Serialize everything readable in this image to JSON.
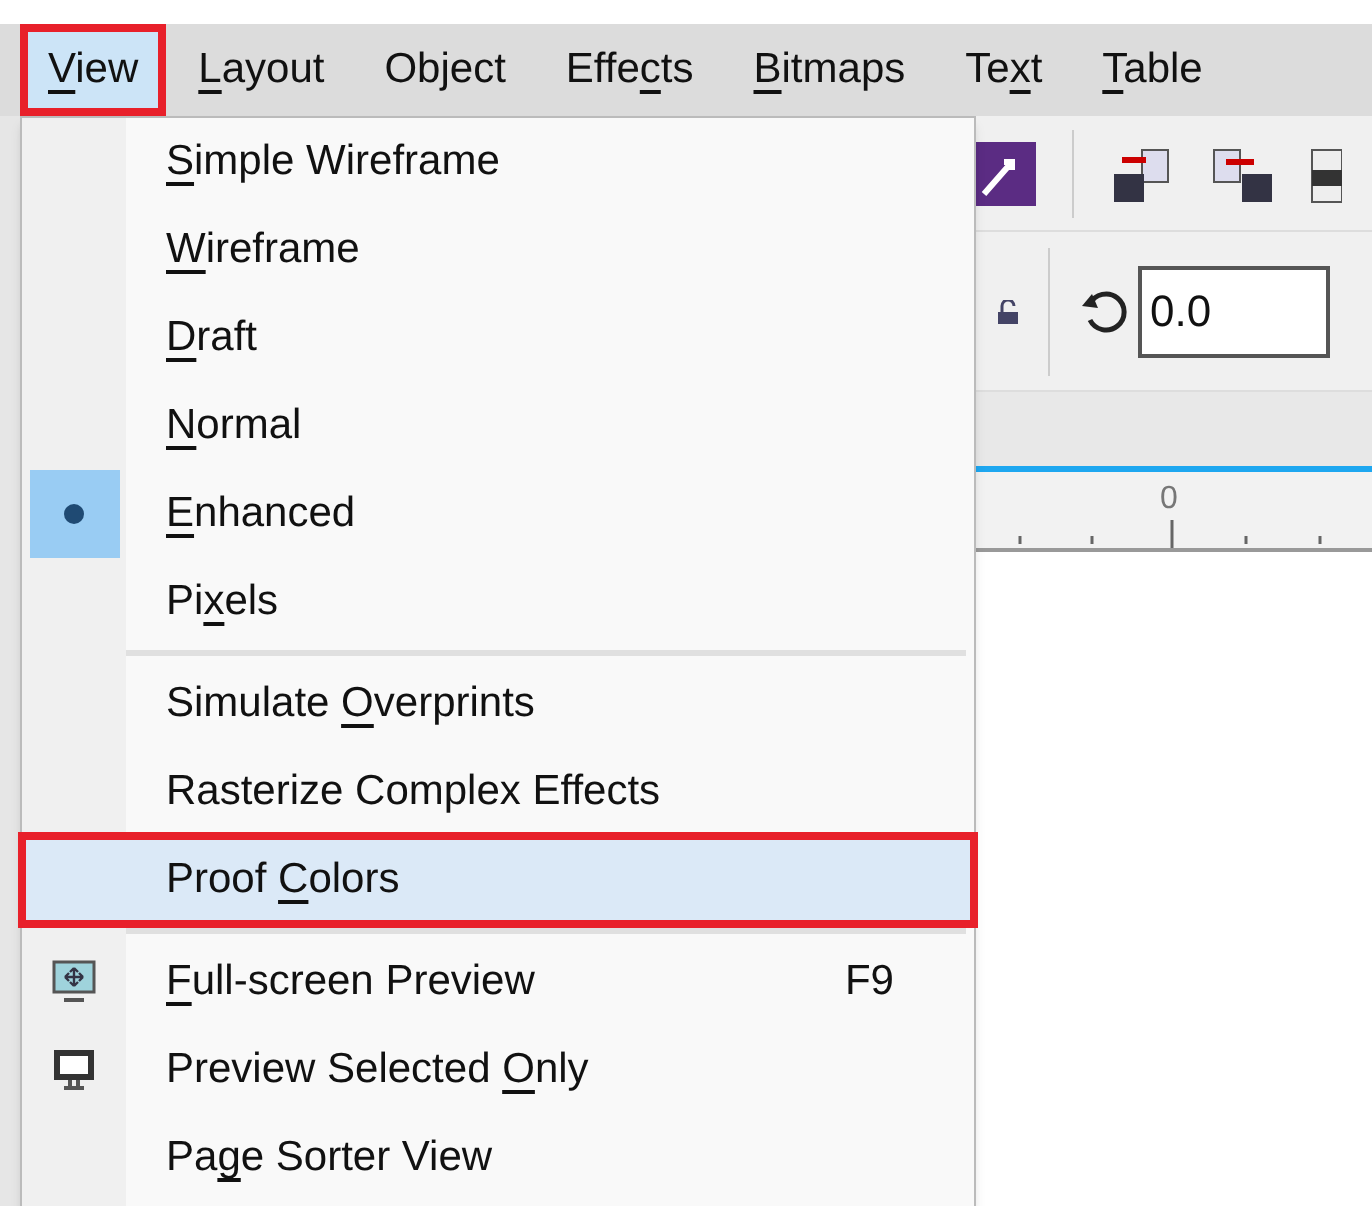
{
  "menu_bar": [
    {
      "label": {
        "key": "V",
        "after": "iew"
      },
      "selected": true,
      "annotated": true
    },
    {
      "label": {
        "key": "L",
        "after": "ayout"
      },
      "selected": false,
      "annotated": false
    },
    {
      "label": {
        "before": "Object"
      },
      "selected": false,
      "annotated": false
    },
    {
      "label": {
        "before": "Effe",
        "key": "c",
        "after": "ts"
      },
      "selected": false,
      "annotated": false
    },
    {
      "label": {
        "key": "B",
        "after": "itmaps"
      },
      "selected": false,
      "annotated": false
    },
    {
      "label": {
        "before": "Te",
        "key": "x",
        "after": "t"
      },
      "selected": false,
      "annotated": false
    },
    {
      "label": {
        "key": "T",
        "after": "able"
      },
      "selected": false,
      "annotated": false
    }
  ],
  "view_menu": [
    {
      "kind": "radio",
      "label": {
        "key": "S",
        "after": "imple Wireframe"
      },
      "checked": false,
      "selected": false,
      "annotated": false
    },
    {
      "kind": "radio",
      "label": {
        "key": "W",
        "after": "ireframe"
      },
      "checked": false,
      "selected": false,
      "annotated": false
    },
    {
      "kind": "radio",
      "label": {
        "key": "D",
        "after": "raft"
      },
      "checked": false,
      "selected": false,
      "annotated": false
    },
    {
      "kind": "radio",
      "label": {
        "key": "N",
        "after": "ormal"
      },
      "checked": false,
      "selected": false,
      "annotated": false
    },
    {
      "kind": "radio",
      "label": {
        "key": "E",
        "after": "nhanced"
      },
      "checked": true,
      "selected": false,
      "annotated": false
    },
    {
      "kind": "radio",
      "label": {
        "before": "Pi",
        "key": "x",
        "after": "els"
      },
      "checked": false,
      "selected": false,
      "annotated": false
    },
    {
      "kind": "separator"
    },
    {
      "kind": "plain",
      "label": {
        "before": "Simulate ",
        "key": "O",
        "after": "verprints"
      },
      "selected": false,
      "annotated": false
    },
    {
      "kind": "plain",
      "label": {
        "before": "Rasterize Complex Effects"
      },
      "selected": false,
      "annotated": false
    },
    {
      "kind": "plain",
      "label": {
        "before": "Proof ",
        "key": "C",
        "after": "olors"
      },
      "selected": true,
      "annotated": true
    },
    {
      "kind": "separator"
    },
    {
      "kind": "fullscreen",
      "label": {
        "key": "F",
        "after": "ull-screen Preview"
      },
      "shortcut": "F9",
      "selected": false,
      "annotated": false
    },
    {
      "kind": "selection",
      "label": {
        "before": "Preview Selected ",
        "key": "O",
        "after": "nly"
      },
      "selected": false,
      "annotated": false
    },
    {
      "kind": "plain",
      "label": {
        "before": "Pa",
        "key": "g",
        "after": "e Sorter View"
      },
      "selected": false,
      "annotated": false
    }
  ],
  "property_bar": {
    "rotation": "0.0"
  },
  "ruler": {
    "label": "0"
  }
}
